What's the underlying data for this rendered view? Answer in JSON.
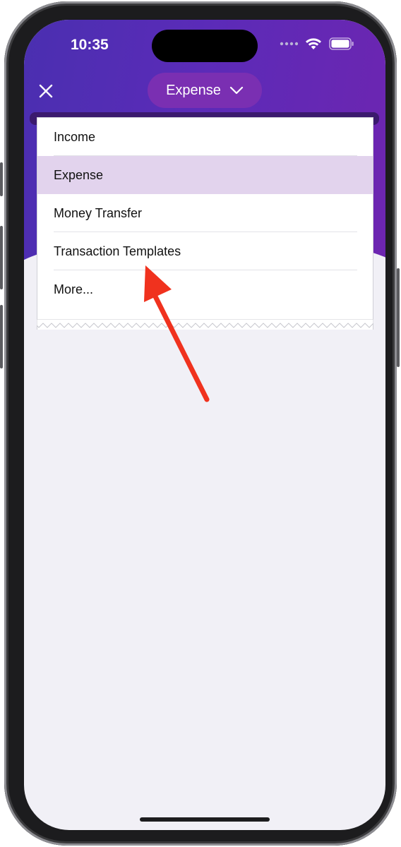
{
  "status_bar": {
    "time": "10:35"
  },
  "header": {
    "close_icon": "close-icon",
    "selector_label": "Expense",
    "selector_icon": "chevron-down-icon",
    "background_color": "#5b2bb8",
    "selector_color": "#7a2fb2"
  },
  "menu": {
    "items": [
      {
        "label": "Income",
        "selected": false
      },
      {
        "label": "Expense",
        "selected": true
      },
      {
        "label": "Money Transfer",
        "selected": false
      },
      {
        "label": "Transaction Templates",
        "selected": false
      },
      {
        "label": "More...",
        "selected": false
      }
    ],
    "selected_color": "#e2d3ed"
  },
  "annotation": {
    "arrow_color": "#f0321e",
    "points_to": "Transaction Templates"
  }
}
